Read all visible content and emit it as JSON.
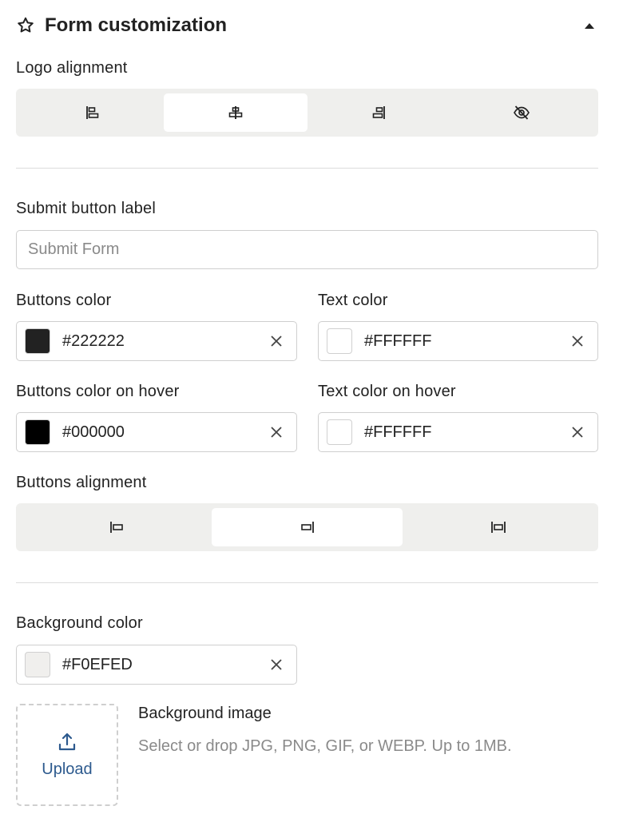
{
  "header": {
    "title": "Form customization",
    "star_icon": "star-outline-icon",
    "collapse_icon": "caret-up-icon"
  },
  "logo_alignment": {
    "label": "Logo alignment",
    "options": [
      {
        "icon": "align-left-icon",
        "selected": false
      },
      {
        "icon": "align-center-icon",
        "selected": true
      },
      {
        "icon": "align-right-icon",
        "selected": false
      },
      {
        "icon": "eye-off-icon",
        "selected": false
      }
    ]
  },
  "submit_label": {
    "label": "Submit button label",
    "placeholder": "Submit Form",
    "value": ""
  },
  "buttons_color": {
    "label": "Buttons color",
    "value": "#222222",
    "swatch": "#222222"
  },
  "text_color": {
    "label": "Text color",
    "value": "#FFFFFF",
    "swatch": "#FFFFFF"
  },
  "buttons_color_hover": {
    "label": "Buttons color on hover",
    "value": "#000000",
    "swatch": "#000000"
  },
  "text_color_hover": {
    "label": "Text color on hover",
    "value": "#FFFFFF",
    "swatch": "#FFFFFF"
  },
  "buttons_alignment": {
    "label": "Buttons alignment",
    "options": [
      {
        "icon": "button-align-left-icon",
        "selected": false
      },
      {
        "icon": "button-align-right-icon",
        "selected": true
      },
      {
        "icon": "button-full-width-icon",
        "selected": false
      }
    ]
  },
  "background_color": {
    "label": "Background color",
    "value": "#F0EFED",
    "swatch": "#F0EFED"
  },
  "background_image": {
    "upload_label": "Upload",
    "title": "Background image",
    "hint": "Select or drop JPG, PNG, GIF, or WEBP. Up to 1MB."
  },
  "colors": {
    "segment_bg": "#EFEFED",
    "accent_link": "#2D5A8E",
    "border": "#CFCFCF"
  }
}
